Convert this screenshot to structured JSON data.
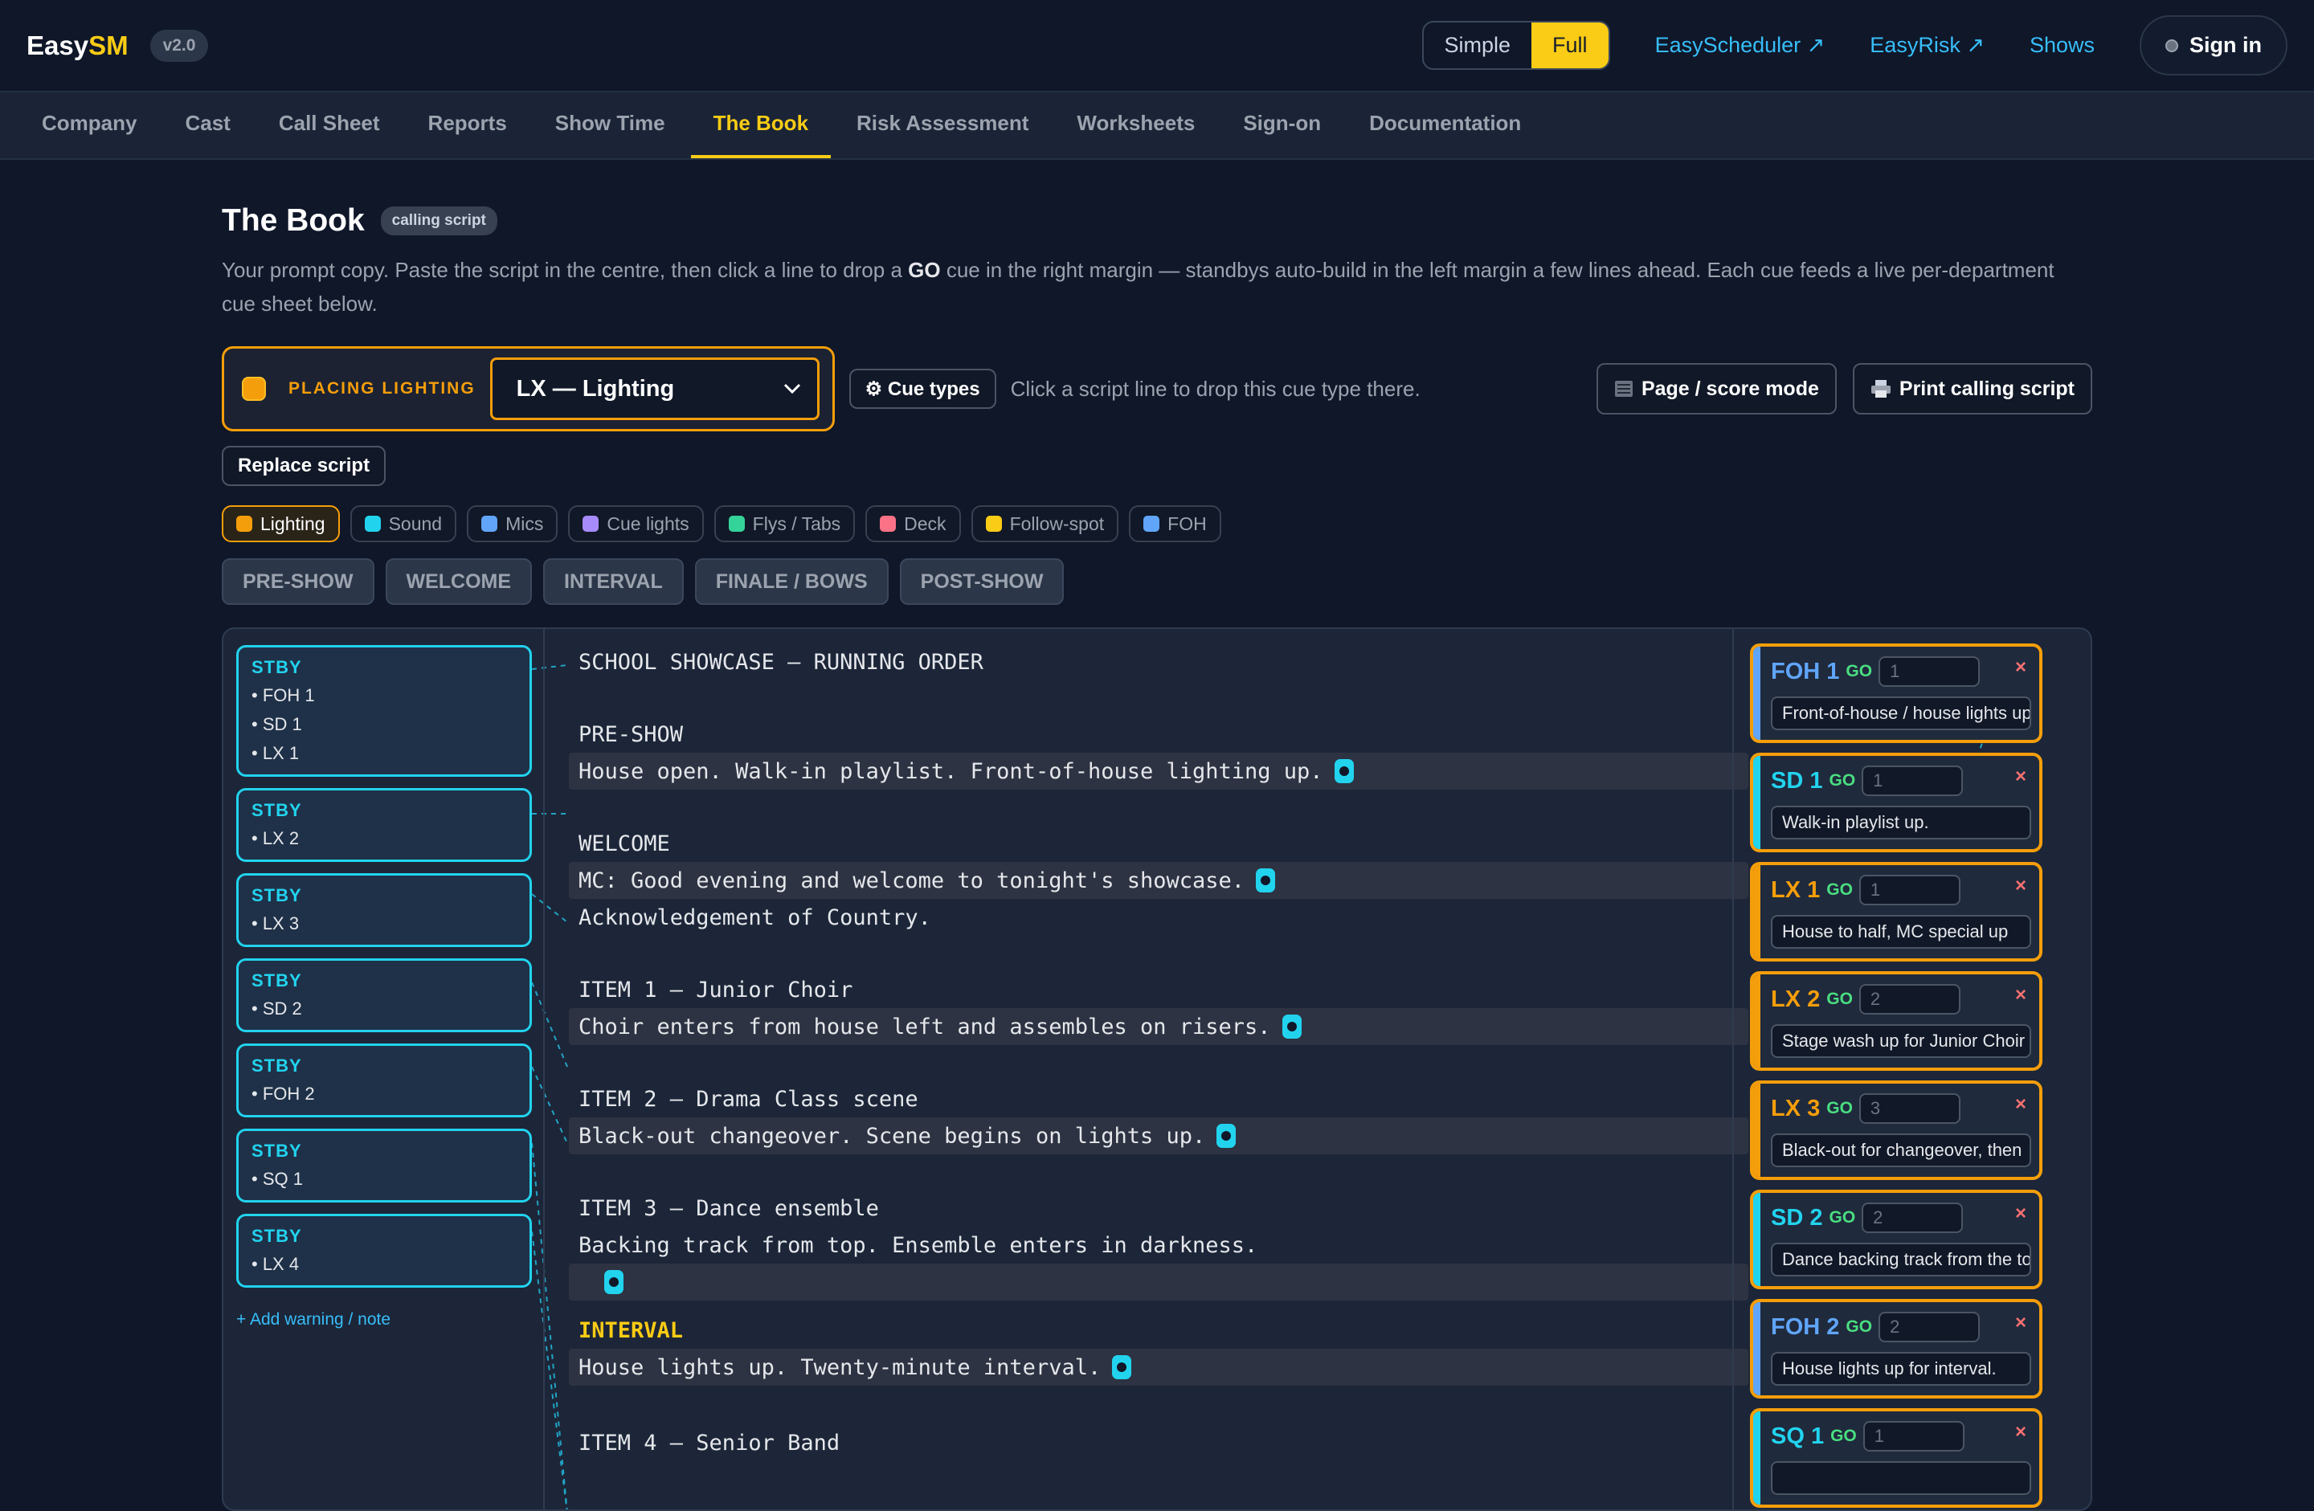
{
  "brand": {
    "prefix": "Easy",
    "accent": "SM",
    "version": "v2.0"
  },
  "mode_toggle": {
    "simple": "Simple",
    "full": "Full"
  },
  "top_links": [
    "EasyScheduler ↗",
    "EasyRisk ↗",
    "Shows"
  ],
  "signin": "Sign in",
  "tabs": [
    "Company",
    "Cast",
    "Call Sheet",
    "Reports",
    "Show Time",
    "The Book",
    "Risk Assessment",
    "Worksheets",
    "Sign-on",
    "Documentation"
  ],
  "page": {
    "title": "The Book",
    "badge": "calling script",
    "desc_a": "Your prompt copy. Paste the script in the centre, then click a line to drop a ",
    "desc_go": "GO",
    "desc_b": " cue in the right margin — standbys auto-build in the left margin a few lines ahead. Each cue feeds a live per-department cue sheet below."
  },
  "placing": {
    "label": "PLACING LIGHTING",
    "select_value": "LX — Lighting"
  },
  "cue_types_button": "⚙ Cue types",
  "hint": "Click a script line to drop this cue type there.",
  "page_score_button": "Page / score mode",
  "print_button": "Print calling script",
  "replace_button": "Replace script",
  "chips": [
    {
      "label": "Lighting",
      "color": "#f59e0b"
    },
    {
      "label": "Sound",
      "color": "#22d3ee"
    },
    {
      "label": "Mics",
      "color": "#60a5fa"
    },
    {
      "label": "Cue lights",
      "color": "#a78bfa"
    },
    {
      "label": "Flys / Tabs",
      "color": "#34d399"
    },
    {
      "label": "Deck",
      "color": "#fb7185"
    },
    {
      "label": "Follow-spot",
      "color": "#facc15"
    },
    {
      "label": "FOH",
      "color": "#60a5fa"
    }
  ],
  "sections": [
    "PRE-SHOW",
    "WELCOME",
    "INTERVAL",
    "FINALE / BOWS",
    "POST-SHOW"
  ],
  "standbys": [
    {
      "title": "STBY",
      "items": [
        "• FOH 1",
        "• SD 1",
        "• LX 1"
      ]
    },
    {
      "title": "STBY",
      "items": [
        "• LX 2"
      ]
    },
    {
      "title": "STBY",
      "items": [
        "• LX 3"
      ]
    },
    {
      "title": "STBY",
      "items": [
        "• SD 2"
      ]
    },
    {
      "title": "STBY",
      "items": [
        "• FOH 2"
      ]
    },
    {
      "title": "STBY",
      "items": [
        "• SQ 1"
      ]
    },
    {
      "title": "STBY",
      "items": [
        "• LX 4"
      ]
    }
  ],
  "add_note": "+ Add warning / note",
  "script_lines": [
    {
      "text": "SCHOOL SHOWCASE — RUNNING ORDER"
    },
    {
      "text": "PRE-SHOW"
    },
    {
      "text": "House open. Walk-in playlist. Front-of-house lighting up."
    },
    {
      "text": "WELCOME"
    },
    {
      "text": "MC: Good evening and welcome to tonight's showcase."
    },
    {
      "text": "Acknowledgement of Country."
    },
    {
      "text": "ITEM 1 — Junior Choir"
    },
    {
      "text": "Choir enters from house left and assembles on risers."
    },
    {
      "text": "ITEM 2 — Drama Class scene"
    },
    {
      "text": "Black-out changeover. Scene begins on lights up."
    },
    {
      "text": "ITEM 3 — Dance ensemble"
    },
    {
      "text": "Backing track from top. Ensemble enters in darkness."
    },
    {
      "text": ""
    },
    {
      "text": "INTERVAL"
    },
    {
      "text": "House lights up. Twenty-minute interval."
    },
    {
      "text": "ITEM 4 — Senior Band"
    }
  ],
  "cues": [
    {
      "name": "FOH 1",
      "go": "GO",
      "number": "1",
      "text": "Front-of-house / house lights up",
      "color": "#60a5fa"
    },
    {
      "name": "SD 1",
      "go": "GO",
      "number": "1",
      "text": "Walk-in playlist up.",
      "color": "#22d3ee"
    },
    {
      "name": "LX 1",
      "go": "GO",
      "number": "1",
      "text": "House to half, MC special up",
      "color": "#f59e0b"
    },
    {
      "name": "LX 2",
      "go": "GO",
      "number": "2",
      "text": "Stage wash up for Junior Choir",
      "color": "#f59e0b"
    },
    {
      "name": "LX 3",
      "go": "GO",
      "number": "3",
      "text": "Black-out for changeover, then",
      "color": "#f59e0b"
    },
    {
      "name": "SD 2",
      "go": "GO",
      "number": "2",
      "text": "Dance backing track from the top",
      "color": "#22d3ee"
    },
    {
      "name": "FOH 2",
      "go": "GO",
      "number": "2",
      "text": "House lights up for interval.",
      "color": "#60a5fa"
    },
    {
      "name": "SQ 1",
      "go": "GO",
      "number": "1",
      "text": "",
      "color": "#22d3ee"
    }
  ],
  "close_glyph": "×"
}
